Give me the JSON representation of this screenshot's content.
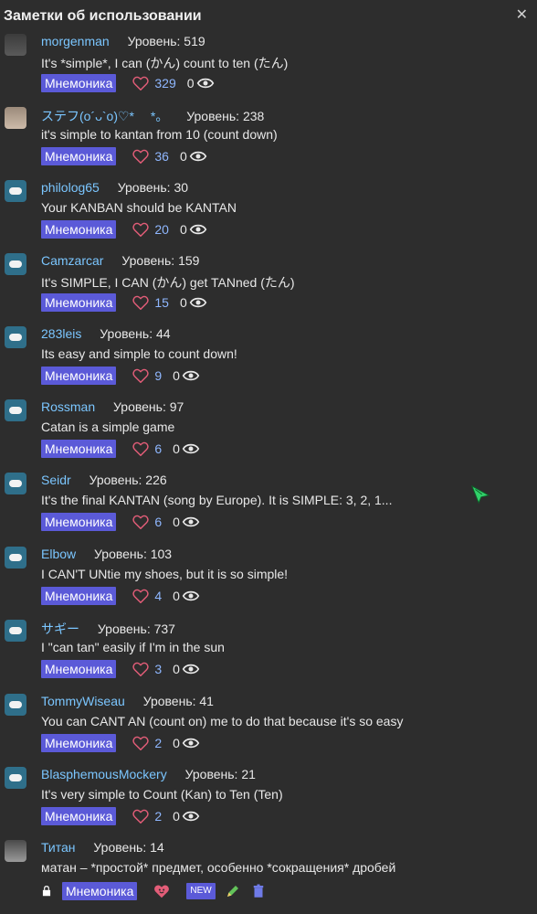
{
  "header": {
    "title": "Заметки об использовании",
    "close": "✕"
  },
  "notes": [
    {
      "username": "morgenman",
      "level": "Уровень: 519",
      "text": "It's *simple*, I can (かん) count to ten (たん)",
      "tag": "Мнемоника",
      "likes": "329",
      "views": "0",
      "avatar": "photo"
    },
    {
      "username": "ステフ(o´ᴗ`o)♡* 　*。",
      "level": "Уровень: 238",
      "text": "it's simple to kantan from 10 (count down)",
      "tag": "Мнемоника",
      "likes": "36",
      "views": "0",
      "avatar": "photo"
    },
    {
      "username": "philolog65",
      "level": "Уровень: 30",
      "text": "Your KANBAN should be KANTAN",
      "tag": "Мнемоника",
      "likes": "20",
      "views": "0",
      "avatar": "cloud"
    },
    {
      "username": "Camzarcar",
      "level": "Уровень: 159",
      "text": "It's SIMPLE, I CAN (かん) get TANned (たん)",
      "tag": "Мнемоника",
      "likes": "15",
      "views": "0",
      "avatar": "cloud"
    },
    {
      "username": "283leis",
      "level": "Уровень: 44",
      "text": "Its easy and simple to count down!",
      "tag": "Мнемоника",
      "likes": "9",
      "views": "0",
      "avatar": "cloud"
    },
    {
      "username": "Rossman",
      "level": "Уровень: 97",
      "text": "Catan is a simple game",
      "tag": "Мнемоника",
      "likes": "6",
      "views": "0",
      "avatar": "cloud"
    },
    {
      "username": "Seidr",
      "level": "Уровень: 226",
      "text": "It's the final KANTAN (song by Europe). It is SIMPLE: 3, 2, 1...",
      "tag": "Мнемоника",
      "likes": "6",
      "views": "0",
      "avatar": "cloud"
    },
    {
      "username": "Elbow",
      "level": "Уровень: 103",
      "text": "I CAN'T UNtie my shoes, but it is so simple!",
      "tag": "Мнемоника",
      "likes": "4",
      "views": "0",
      "avatar": "cloud"
    },
    {
      "username": "サギー",
      "level": "Уровень: 737",
      "text": "I \"can tan\" easily if I'm in the sun",
      "tag": "Мнемоника",
      "likes": "3",
      "views": "0",
      "avatar": "cloud"
    },
    {
      "username": "TommyWiseau",
      "level": "Уровень: 41",
      "text": "You can CANT AN (count on) me to do that because it's so easy",
      "tag": "Мнемоника",
      "likes": "2",
      "views": "0",
      "avatar": "cloud"
    },
    {
      "username": "BlasphemousMockery",
      "level": "Уровень: 21",
      "text": "It's very simple to Count (Kan) to Ten (Ten)",
      "tag": "Мнемоника",
      "likes": "2",
      "views": "0",
      "avatar": "cloud"
    }
  ],
  "own_note": {
    "username": "Титан",
    "level": "Уровень: 14",
    "text": "матан – *простой* предмет, особенно *сокращения* дробей",
    "tag": "Мнемоника",
    "new_label": "NEW"
  },
  "colors": {
    "accent": "#5b5ad8",
    "username": "#7bc6ff",
    "heart": "#e35d78",
    "likes": "#8fb7ff"
  }
}
